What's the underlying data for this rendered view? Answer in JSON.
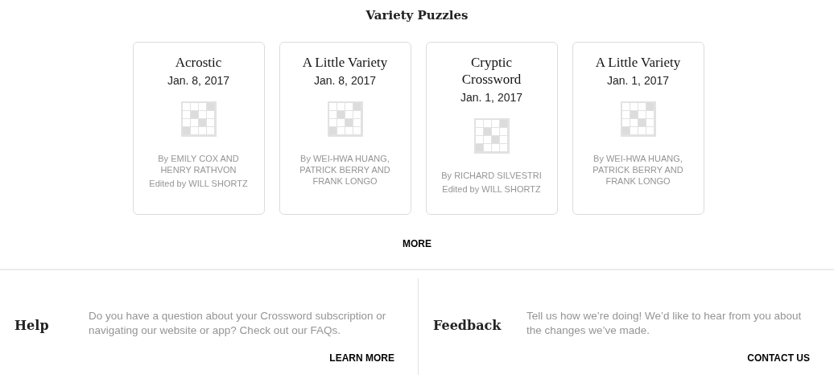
{
  "section_title": "Variety Puzzles",
  "puzzles": [
    {
      "title": "Acrostic",
      "date": "Jan. 8, 2017",
      "byline": "By EMILY COX AND HENRY RATHVON",
      "editor": "Edited by WILL SHORTZ"
    },
    {
      "title": "A Little Variety",
      "date": "Jan. 8, 2017",
      "byline": "By WEI-HWA HUANG, PATRICK BERRY AND FRANK LONGO"
    },
    {
      "title": "Cryptic Crossword",
      "date": "Jan. 1, 2017",
      "byline": "By RICHARD SILVESTRI",
      "editor": "Edited by WILL SHORTZ"
    },
    {
      "title": "A Little Variety",
      "date": "Jan. 1, 2017",
      "byline": "By WEI-HWA HUANG, PATRICK BERRY AND FRANK LONGO"
    }
  ],
  "more_link": "MORE",
  "footer": [
    {
      "heading": "Help",
      "text": "Do you have a question about your Crossword subscription or navigating our website or app? Check out our FAQs.",
      "link": "LEARN MORE"
    },
    {
      "heading": "Feedback",
      "text": "Tell us how we’re doing! We’d like to hear from you about the changes we’ve made.",
      "link": "CONTACT US"
    }
  ]
}
